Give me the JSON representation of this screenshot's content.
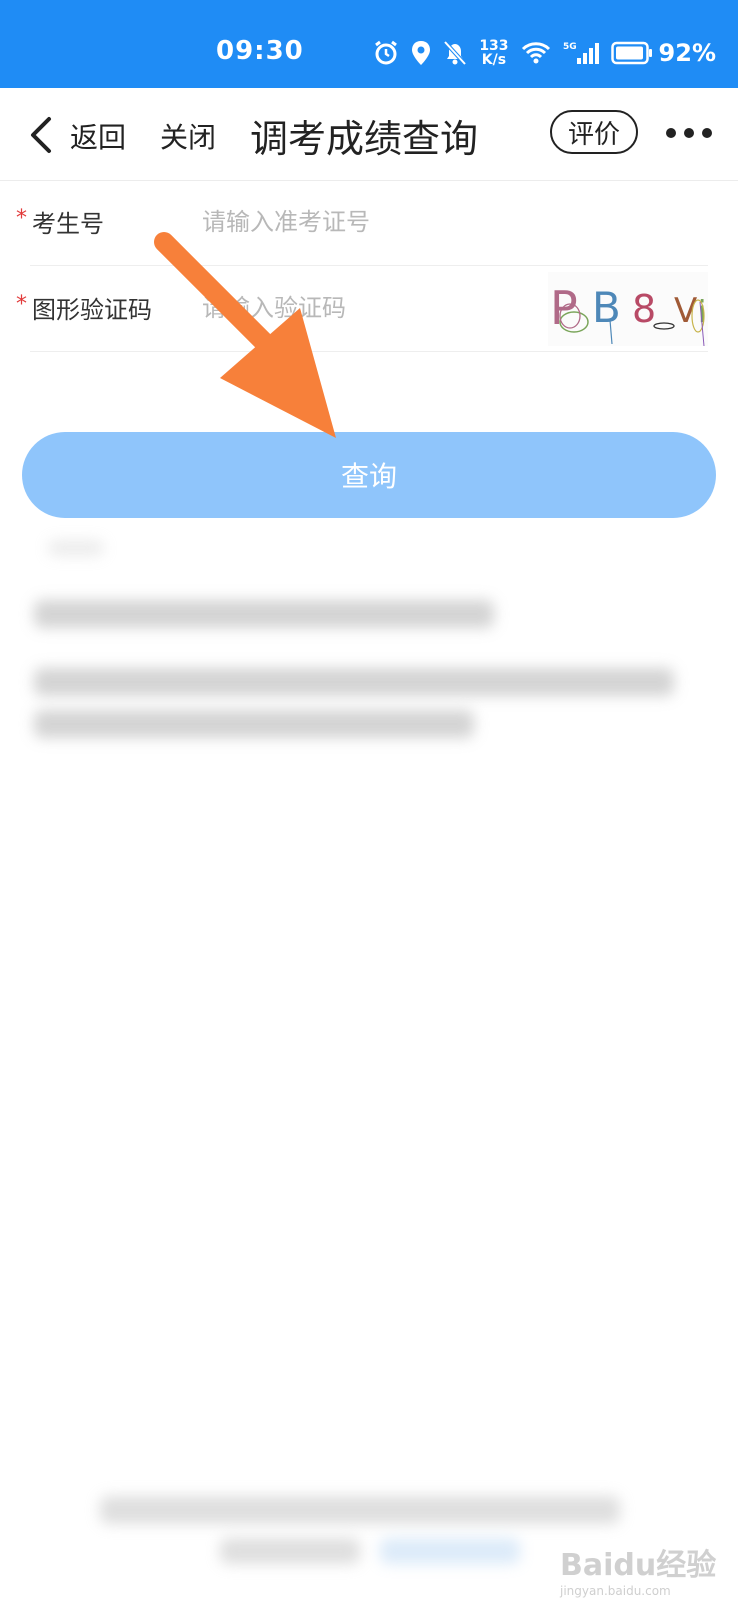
{
  "status_bar": {
    "time": "09:30",
    "net_speed_value": "133",
    "net_speed_unit": "K/s",
    "battery_percent": "92%"
  },
  "nav": {
    "back_label": "返回",
    "close_label": "关闭",
    "title": "调考成绩查询",
    "rate_label": "评价"
  },
  "form": {
    "fields": [
      {
        "required": "*",
        "label": "考生号",
        "placeholder": "请输入准考证号",
        "value": ""
      },
      {
        "required": "*",
        "label": "图形验证码",
        "placeholder": "请输入验证码",
        "value": ""
      }
    ],
    "captcha_text": "P B 8 V i"
  },
  "query_button_label": "查询",
  "watermark": {
    "text": "Baidu经验",
    "url_text": "jingyan.baidu.com"
  },
  "colors": {
    "status_bar_bg": "#1f8cf5",
    "query_button_bg": "#8fc5fb",
    "required_star": "#e23b3b",
    "arrow": "#f7803a"
  }
}
